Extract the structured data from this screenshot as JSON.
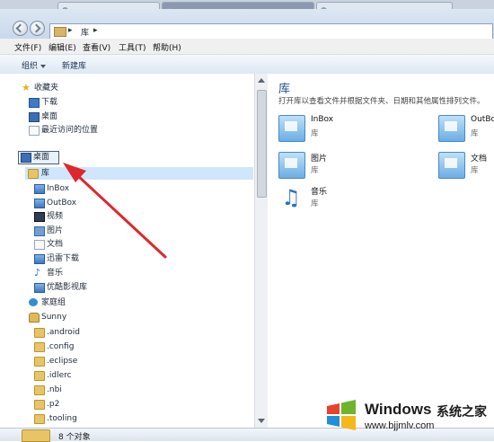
{
  "address": {
    "location": "库"
  },
  "menu": [
    "文件(F)",
    "编辑(E)",
    "查看(V)",
    "工具(T)",
    "帮助(H)"
  ],
  "toolbar": {
    "organize": "组织",
    "new_library": "新建库"
  },
  "nav": {
    "favorites": "收藏夹",
    "fav_items": [
      "下载",
      "桌面",
      "最近访问的位置"
    ],
    "desktop": "桌面",
    "libraries": "库",
    "library_items": [
      "InBox",
      "OutBox",
      "视频",
      "图片",
      "文档",
      "迅雷下载",
      "音乐",
      "优酷影视库"
    ],
    "homegroup": "家庭组",
    "user": "Sunny",
    "user_folders": [
      ".android",
      ".config",
      ".eclipse",
      ".idlerc",
      ".nbi",
      ".p2",
      ".tooling"
    ]
  },
  "content": {
    "title": "库",
    "description": "打开库以查看文件并根据文件夹、日期和其他属性排列文件。",
    "items": [
      {
        "name": "InBox",
        "type": "库"
      },
      {
        "name": "OutBox",
        "type": "库"
      },
      {
        "name": "图片",
        "type": "库"
      },
      {
        "name": "文档",
        "type": "库"
      },
      {
        "name": "音乐",
        "type": "库"
      }
    ]
  },
  "status": {
    "count": "8 个对象"
  },
  "watermark": {
    "brand": "Windows",
    "suffix": "系统之家",
    "url": "www.bjjmlv.com"
  },
  "colors": {
    "annotation_arrow": "#e0262d",
    "title_blue": "#1e4f91"
  }
}
